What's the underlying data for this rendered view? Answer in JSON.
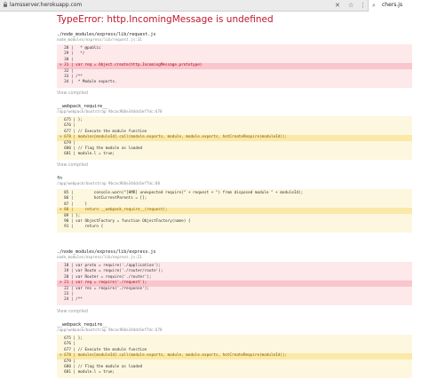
{
  "browser": {
    "url": "lamsserver.herokuapp.com",
    "find_value": "chers.js"
  },
  "error_title": "TypeError: http.IncomingMessage is undefined",
  "frames": [
    {
      "name": "./node_modules/express/lib/request.js",
      "location": "node_modules/express/lib/request.js:31",
      "theme": "red",
      "lines": [
        {
          "t": "  28 |   * @public",
          "hl": false
        },
        {
          "t": "  29 |   */",
          "hl": false
        },
        {
          "t": "  30 | ",
          "hl": false
        },
        {
          "t": "> 31 | var req = Object.create(http.IncomingMessage.prototype)",
          "hl": true
        },
        {
          "t": "  32 | ",
          "hl": false
        },
        {
          "t": "  33 | /**",
          "hl": false
        },
        {
          "t": "  34 |  * Module exports.",
          "hl": false
        }
      ],
      "view_compiled": "View compiled"
    },
    {
      "name": "__webpack_require__",
      "location": "/app/webpack/bootstrap 9bcac966e344dc6ef7dc:678",
      "theme": "yellow",
      "lines": [
        {
          "t": "  675 | };",
          "hl": false
        },
        {
          "t": "  676 | ",
          "hl": false
        },
        {
          "t": "  677 | // Execute the module function",
          "hl": false
        },
        {
          "t": "> 678 | modules[moduleId].call(module.exports, module, module.exports, hotCreateRequire(moduleId));",
          "hl": true
        },
        {
          "t": "  679 | ",
          "hl": false
        },
        {
          "t": "  680 | // Flag the module as loaded",
          "hl": false
        },
        {
          "t": "  681 | module.l = true;",
          "hl": false
        }
      ],
      "view_compiled": "View compiled"
    },
    {
      "name": "fn",
      "location": "/app/webpack/bootstrap 9bcac966e344dc6ef7dc:88",
      "theme": "yellow",
      "lines": [
        {
          "t": "  85 |         console.warn(\"[HMR] unexpected require(\" + request + \") from disposed module \" + moduleId);",
          "hl": false
        },
        {
          "t": "  86 |         hotCurrentParents = [];",
          "hl": false
        },
        {
          "t": "  87 |     }",
          "hl": false
        },
        {
          "t": "> 88 |     return __webpack_require__(request);",
          "hl": true
        },
        {
          "t": "  89 | };",
          "hl": false
        },
        {
          "t": "  90 | var ObjectFactory = function ObjectFactory(name) {",
          "hl": false
        },
        {
          "t": "  91 |     return {",
          "hl": false
        }
      ],
      "view_compiled": ""
    },
    {
      "name": "./node_modules/express/lib/express.js",
      "location": "node_modules/express/lib/express.js:21",
      "theme": "red",
      "lines": [
        {
          "t": "  18 | var proto = require('./application');",
          "hl": false
        },
        {
          "t": "  19 | var Route = require('./router/route');",
          "hl": false
        },
        {
          "t": "  20 | var Router = require('./router');",
          "hl": false
        },
        {
          "t": "> 21 | var req = require('./request');",
          "hl": true
        },
        {
          "t": "  22 | var res = require('./response');",
          "hl": false
        },
        {
          "t": "  23 | ",
          "hl": false
        },
        {
          "t": "  24 | /**",
          "hl": false
        }
      ],
      "view_compiled": "View compiled"
    },
    {
      "name": "__webpack_require__",
      "location": "/app/webpack/bootstrap 9bcac966e344dc6ef7dc:678",
      "theme": "yellow",
      "lines": [
        {
          "t": "  675 | };",
          "hl": false
        },
        {
          "t": "  676 | ",
          "hl": false
        },
        {
          "t": "  677 | // Execute the module function",
          "hl": false
        },
        {
          "t": "> 678 | modules[moduleId].call(module.exports, module, module.exports, hotCreateRequire(moduleId));",
          "hl": true
        },
        {
          "t": "  679 | ",
          "hl": false
        },
        {
          "t": "  680 | // Flag the module as loaded",
          "hl": false
        },
        {
          "t": "  681 | module.l = true;",
          "hl": false
        }
      ],
      "view_compiled": ""
    }
  ],
  "colors": {
    "error_red": "#c0172b",
    "red_bg": "#fde8ea",
    "yellow_bg": "#fdf7df"
  },
  "icons": {
    "lock": "lock-icon",
    "star": "star-icon",
    "close": "close-icon",
    "search": "search-icon"
  }
}
